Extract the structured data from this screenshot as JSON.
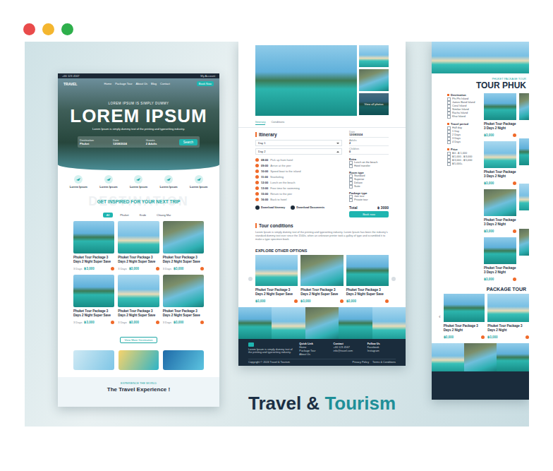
{
  "window": {
    "dots": [
      {
        "color": "#e94b4b"
      },
      {
        "color": "#f4b62f"
      },
      {
        "color": "#2eaf4b"
      }
    ]
  },
  "caption": {
    "first": "Travel &",
    "second": "Tourism"
  },
  "home": {
    "topbar": {
      "phone": "+66 123 4567",
      "account": "My Account"
    },
    "logo": "TRAVEL",
    "nav": [
      "Home",
      "Package Tour",
      "About Us",
      "Blog",
      "Contact"
    ],
    "nav_button": "Book Now",
    "hero": {
      "kicker": "LOREM IPSUM IS SIMPLY DUMMY",
      "title": "LOREM IPSUM",
      "subtitle": "Lorem Ipsum is simply dummy text of the printing and typesetting industry."
    },
    "search": {
      "fields": [
        {
          "label": "Destination",
          "value": "Phuket"
        },
        {
          "label": "Date",
          "value": "12/08/2024"
        },
        {
          "label": "Guests",
          "value": "2 Adults"
        }
      ],
      "button": "Search"
    },
    "features": [
      {
        "title": "Lorem Ipsum"
      },
      {
        "title": "Lorem Ipsum"
      },
      {
        "title": "Lorem Ipsum"
      },
      {
        "title": "Lorem Ipsum"
      },
      {
        "title": "Lorem Ipsum"
      }
    ],
    "watermark": "DESTINATION",
    "section_title": "GET INSPIRED FOR YOUR NEXT TRIP",
    "filters": [
      {
        "label": "All",
        "selected": true
      },
      {
        "label": "Phuket",
        "selected": false
      },
      {
        "label": "Krabi",
        "selected": false
      },
      {
        "label": "Chiang Mai",
        "selected": false
      }
    ],
    "cards": [
      {
        "title": "Phuket Tour Package 3 Days 2 Night Super Save",
        "duration": "3 Days",
        "price": "฿3,000"
      },
      {
        "title": "Phuket Tour Package 3 Days 2 Night Super Save",
        "duration": "3 Days",
        "price": "฿3,000"
      },
      {
        "title": "Phuket Tour Package 3 Days 2 Night Super Save",
        "duration": "3 Days",
        "price": "฿3,000"
      },
      {
        "title": "Phuket Tour Package 3 Days 2 Night Super Save",
        "duration": "3 Days",
        "price": "฿3,000"
      },
      {
        "title": "Phuket Tour Package 3 Days 2 Night Super Save",
        "duration": "3 Days",
        "price": "฿3,000"
      },
      {
        "title": "Phuket Tour Package 3 Days 2 Night Super Save",
        "duration": "3 Days",
        "price": "฿3,000"
      }
    ],
    "more_button": "View More Destination",
    "footer": {
      "kicker": "EXPERIENCE THE WORLD",
      "title": "The Travel Experience !"
    }
  },
  "detail": {
    "more_photos": "View all photos",
    "tabs": [
      {
        "label": "Itinerary",
        "selected": true
      },
      {
        "label": "Conditions",
        "selected": false
      }
    ],
    "itinerary_title": "Itinerary",
    "days": [
      {
        "label": "Day 1",
        "expanded": false
      },
      {
        "label": "Day 2",
        "expanded": true
      }
    ],
    "steps": [
      {
        "time": "08:00",
        "text": "Pick up from hotel"
      },
      {
        "time": "09:00",
        "text": "Arrive at the pier"
      },
      {
        "time": "10:00",
        "text": "Speed boat to the island"
      },
      {
        "time": "11:00",
        "text": "Snorkeling"
      },
      {
        "time": "12:00",
        "text": "Lunch on the beach"
      },
      {
        "time": "13:00",
        "text": "Free time for swimming"
      },
      {
        "time": "15:00",
        "text": "Return to the pier"
      },
      {
        "time": "16:00",
        "text": "Back to hotel"
      }
    ],
    "downloads": [
      "Download Itinerary",
      "Download Documents"
    ],
    "conditions_title": "Tour conditions",
    "conditions_text": "Lorem Ipsum is simply dummy text of the printing and typesetting industry. Lorem Ipsum has been the industry's standard dummy text ever since the 1500s, when an unknown printer took a galley of type and scrambled it to make a type specimen book.",
    "booking": {
      "fields": [
        {
          "label": "Date",
          "value": "12/08/2024"
        },
        {
          "label": "Adults",
          "value": "2"
        },
        {
          "label": "Children",
          "value": "0"
        }
      ],
      "groups": [
        {
          "title": "Extra",
          "options": [
            {
              "label": "Lunch on the beach",
              "checked": false
            },
            {
              "label": "Hotel transfer",
              "checked": false
            }
          ]
        },
        {
          "title": "Room type",
          "options": [
            {
              "label": "Standard",
              "checked": false
            },
            {
              "label": "Superior",
              "checked": false
            },
            {
              "label": "Deluxe",
              "checked": false
            },
            {
              "label": "Suite",
              "checked": false
            }
          ]
        },
        {
          "title": "Package type",
          "options": [
            {
              "label": "Join tour",
              "checked": false
            },
            {
              "label": "Private tour",
              "checked": false
            }
          ]
        }
      ],
      "total_label": "Total",
      "total": "฿ 3000",
      "button": "Book now"
    },
    "explore_title": "EXPLORE OTHER OPTIONS",
    "options": [
      {
        "title": "Phuket Tour Package 3 Days 2 Night Super Save",
        "price": "฿3,000"
      },
      {
        "title": "Phuket Tour Package 3 Days 2 Night Super Save",
        "price": "฿3,000"
      },
      {
        "title": "Phuket Tour Package 3 Days 2 Night Super Save",
        "price": "฿3,000"
      }
    ],
    "footer": {
      "about": "Lorem Ipsum is simply dummy text of the printing and typesetting industry.",
      "columns": [
        {
          "title": "Quick Link",
          "items": [
            "Home",
            "Package Tour",
            "About Us"
          ]
        },
        {
          "title": "Contact",
          "items": [
            "+66 123 4567",
            "info@travel.com"
          ]
        },
        {
          "title": "Follow Us",
          "items": [
            "Facebook",
            "Instagram"
          ]
        }
      ],
      "copyright": "Copyright © 2024 Travel & Tourism",
      "legal": [
        "Privacy Policy",
        "Terms & Conditions"
      ]
    }
  },
  "tour": {
    "kicker": "PHUKET PACKAGE TOUR",
    "title": "TOUR PHUK",
    "filter_groups": [
      {
        "title": "Destination",
        "items": [
          {
            "label": "Phi Phi Island",
            "checked": false
          },
          {
            "label": "James Bond Island",
            "checked": false
          },
          {
            "label": "Coral Island",
            "checked": false
          },
          {
            "label": "Similan Island",
            "checked": false
          },
          {
            "label": "Racha Island",
            "checked": false
          },
          {
            "label": "Khai Island",
            "checked": false
          }
        ]
      },
      {
        "title": "Travel period",
        "items": [
          {
            "label": "Half day",
            "checked": false
          },
          {
            "label": "1 Day",
            "checked": false
          },
          {
            "label": "2 Days",
            "checked": false
          },
          {
            "label": "3 Days",
            "checked": false
          },
          {
            "label": "4 Days",
            "checked": false
          }
        ]
      },
      {
        "title": "Price",
        "items": [
          {
            "label": "฿0 - ฿1,000",
            "checked": false
          },
          {
            "label": "฿1,000 - ฿3,000",
            "checked": false
          },
          {
            "label": "฿3,000 - ฿5,000",
            "checked": false
          },
          {
            "label": "฿5,000+",
            "checked": false
          }
        ]
      }
    ],
    "cards": [
      {
        "title": "Phuket Tour Package 3 Days 2 Night",
        "price": "฿3,000"
      },
      {
        "title": "Phuket Tour Package 3 Days 2 Night",
        "price": "฿3,000"
      },
      {
        "title": "Phuket Tour Package 3 Days 2 Night",
        "price": "฿3,000"
      },
      {
        "title": "Phuket Tour Package 3 Days 2 Night",
        "price": "฿3,000"
      }
    ],
    "package_title": "PACKAGE TOUR",
    "package_cards": [
      {
        "title": "Phuket Tour Package 3 Days 2 Night",
        "price": "฿3,000"
      },
      {
        "title": "Phuket Tour Package 3 Days 2 Night",
        "price": "฿3,000"
      }
    ],
    "prev": "‹"
  }
}
